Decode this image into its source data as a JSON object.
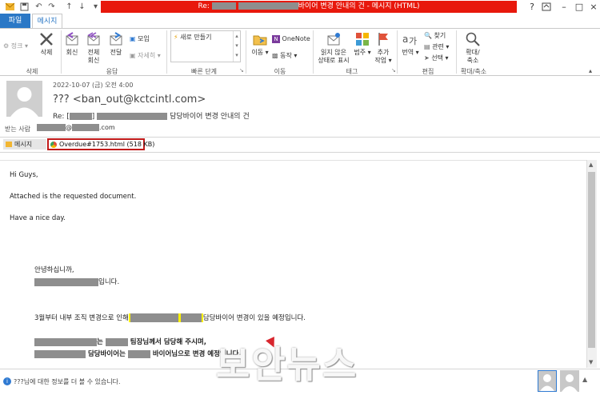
{
  "titlebar": {
    "title_prefix": "Re: ",
    "title_suffix": "바이어 변경 안내의 건 - 메시지 (HTML)",
    "help": "?",
    "minimize": "–",
    "restore": "□",
    "close": "×"
  },
  "tabs": {
    "file": "파일",
    "message": "메시지"
  },
  "ribbon": {
    "junk": "정크",
    "delete": "삭제",
    "reply": "회신",
    "reply_all_1": "전체",
    "reply_all_2": "회신",
    "forward": "전달",
    "meeting": "모임",
    "more": "자세히",
    "quick_steps_item": "새로 만들기",
    "move": "이동",
    "onenote": "OneNote",
    "actions": "동작",
    "unread_1": "읽지 않은",
    "unread_2": "상태로 표시",
    "categorize": "범주",
    "followup_1": "추가",
    "followup_2": "작업",
    "translate": "번역",
    "find": "찾기",
    "related": "관련",
    "select": "선택",
    "zoom_1": "확대/",
    "zoom_2": "축소",
    "groups": {
      "delete": "삭제",
      "respond": "응답",
      "quick_steps": "빠른 단계",
      "move": "이동",
      "tags": "태그",
      "editing": "편집",
      "zoom": "확대/축소"
    }
  },
  "header": {
    "date": "2022-10-07 (금) 오전 4:00",
    "sender": "??? <ban_out@kctcintl.com>",
    "subject_prefix": "Re: [",
    "subject_bracket": "]",
    "subject_suffix": "담당바이어 변경 안내의 건",
    "to_label": "받는 사람",
    "to_at": "@",
    "to_domain": ".com"
  },
  "attachments": {
    "message_tab": "메시지",
    "file": "Overdue#1753.html (518 KB)"
  },
  "body": {
    "line1": "Hi Guys,",
    "line2": "Attached is the requested document.",
    "line3": "Have a nice day.",
    "greeting": "안녕하십니까,",
    "intro_suffix": "입니다.",
    "change_prefix": "3월부터 내부 조직 변경으로 인해",
    "change_suffix": "담당바이어 변경이 있을 예정입니다.",
    "assign_mid": "는",
    "assign_suffix": "팀장님께서 담당해 주시며,",
    "buyer_prefix": "담당바이어는",
    "buyer_suffix": "바이어님으로 변경 예정입니다."
  },
  "status": {
    "info": "???님에 대한 정보를 더 볼 수 있습니다."
  },
  "watermark": "보안뉴스"
}
